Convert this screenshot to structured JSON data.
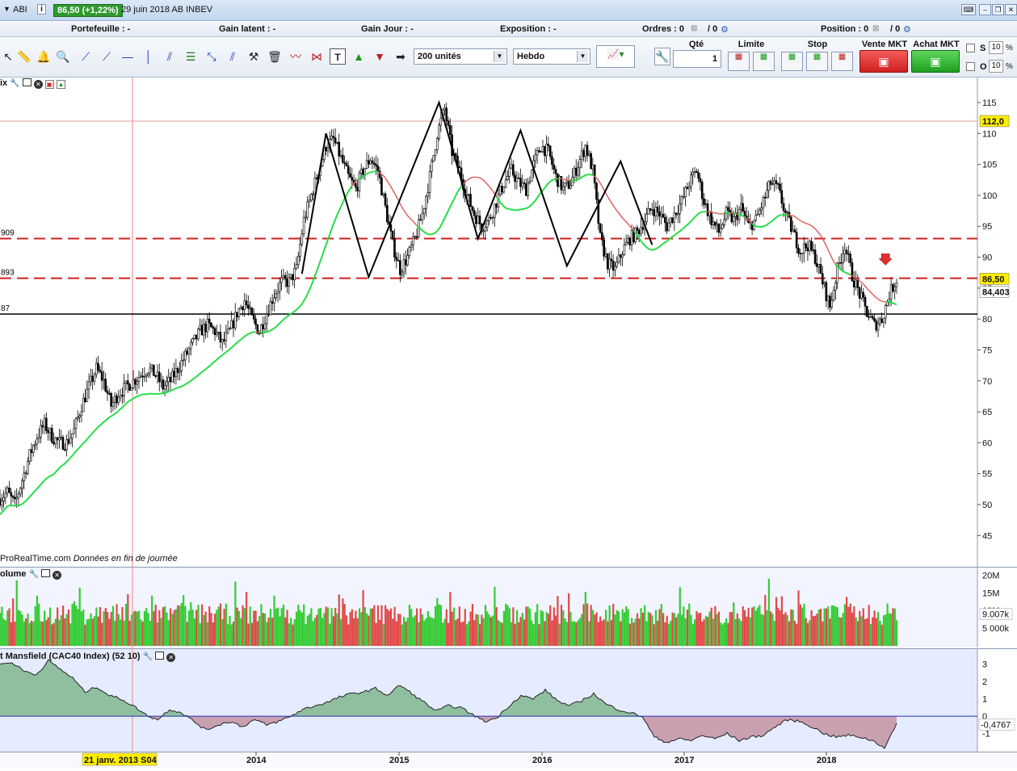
{
  "window": {
    "ticker": "ABI",
    "price_badge": "86,50 (+1,22%)",
    "title": "29 juin 2018 AB INBEV"
  },
  "infobar": {
    "portefeuille": "Portefeuille : -",
    "gain_latent": "Gain latent : -",
    "gain_jour": "Gain Jour : -",
    "exposition": "Exposition : -",
    "ordres": "Ordres : 0",
    "ordres2": "/ 0",
    "position": "Position : 0",
    "position2": "/ 0"
  },
  "toolbar": {
    "units_select": "200 unités",
    "period_select": "Hebdo",
    "qte_label": "Qté",
    "qte_value": "1",
    "limite_label": "Limite",
    "stop_label": "Stop",
    "vente_label": "Vente MKT",
    "achat_label": "Achat MKT",
    "s_label": "S",
    "o_label": "O",
    "pct1": "10",
    "pct2": "10",
    "pct_sign": "%"
  },
  "panels": {
    "price_title": "ix",
    "volume_title": "olume",
    "mansfield_title": "t Mansfield (CAC40 Index) (52 10)",
    "source_note": "ProRealTime.com",
    "source_note2": "Données en fin de journée"
  },
  "chart_data": [
    {
      "type": "candlestick",
      "name": "price",
      "y_ticks": [
        45,
        50,
        55,
        60,
        65,
        70,
        75,
        80,
        85,
        90,
        95,
        100,
        105,
        110,
        115
      ],
      "ylim": [
        41,
        118
      ],
      "x_years": [
        "2014",
        "2015",
        "2016",
        "2017",
        "2018"
      ],
      "cursor_label": "21 janv. 2013 S04",
      "price_tags": {
        "resistance": "112,0",
        "last": "86,50",
        "ma": "84,403"
      },
      "levels": [
        {
          "value": 93.0,
          "label": "909",
          "style": "dashed",
          "color": "#d21f1f"
        },
        {
          "value": 86.6,
          "label": "893",
          "style": "dashed",
          "color": "#d21f1f"
        },
        {
          "value": 80.8,
          "label": "87",
          "style": "solid",
          "color": "#000000"
        },
        {
          "value": 112.0,
          "label": "",
          "style": "thin",
          "color": "#d08080"
        }
      ],
      "close_path": [
        [
          0,
          51
        ],
        [
          4,
          52
        ],
        [
          8,
          50
        ],
        [
          12,
          54
        ],
        [
          16,
          58
        ],
        [
          20,
          61
        ],
        [
          24,
          63
        ],
        [
          28,
          61
        ],
        [
          32,
          60
        ],
        [
          36,
          60
        ],
        [
          40,
          62
        ],
        [
          44,
          66
        ],
        [
          48,
          69
        ],
        [
          52,
          72
        ],
        [
          56,
          70
        ],
        [
          60,
          66
        ],
        [
          64,
          68
        ],
        [
          68,
          69
        ],
        [
          72,
          70
        ],
        [
          76,
          71
        ],
        [
          80,
          72
        ],
        [
          84,
          71
        ],
        [
          88,
          69
        ],
        [
          92,
          70
        ],
        [
          96,
          72
        ],
        [
          100,
          74
        ],
        [
          104,
          76
        ],
        [
          108,
          78
        ],
        [
          112,
          79
        ],
        [
          116,
          78
        ],
        [
          120,
          76
        ],
        [
          124,
          78
        ],
        [
          128,
          81
        ],
        [
          132,
          83
        ],
        [
          136,
          80
        ],
        [
          140,
          78
        ],
        [
          144,
          81
        ],
        [
          148,
          84
        ],
        [
          152,
          86
        ],
        [
          156,
          86
        ],
        [
          160,
          88
        ],
        [
          164,
          96
        ],
        [
          168,
          100
        ],
        [
          172,
          104
        ],
        [
          176,
          108
        ],
        [
          180,
          109
        ],
        [
          184,
          106
        ],
        [
          188,
          103
        ],
        [
          192,
          101
        ],
        [
          196,
          104
        ],
        [
          200,
          106
        ],
        [
          204,
          104
        ],
        [
          208,
          98
        ],
        [
          212,
          92
        ],
        [
          216,
          88
        ],
        [
          220,
          90
        ],
        [
          224,
          93
        ],
        [
          228,
          97
        ],
        [
          232,
          103
        ],
        [
          236,
          110
        ],
        [
          240,
          114
        ],
        [
          244,
          107
        ],
        [
          248,
          104
        ],
        [
          252,
          100
        ],
        [
          256,
          97
        ],
        [
          260,
          95
        ],
        [
          264,
          96
        ],
        [
          268,
          99
        ],
        [
          272,
          102
        ],
        [
          276,
          104
        ],
        [
          280,
          102
        ],
        [
          284,
          101
        ],
        [
          288,
          105
        ],
        [
          292,
          108
        ],
        [
          296,
          107
        ],
        [
          300,
          103
        ],
        [
          304,
          101
        ],
        [
          308,
          102
        ],
        [
          312,
          105
        ],
        [
          316,
          108
        ],
        [
          320,
          104
        ],
        [
          324,
          93
        ],
        [
          328,
          89
        ],
        [
          332,
          88
        ],
        [
          336,
          91
        ],
        [
          340,
          93
        ],
        [
          344,
          94
        ],
        [
          348,
          96
        ],
        [
          352,
          98
        ],
        [
          356,
          97
        ],
        [
          360,
          95
        ],
        [
          364,
          97
        ],
        [
          368,
          99
        ],
        [
          372,
          102
        ],
        [
          376,
          104
        ],
        [
          380,
          99
        ],
        [
          384,
          96
        ],
        [
          388,
          94
        ],
        [
          392,
          97
        ],
        [
          396,
          96
        ],
        [
          400,
          98
        ],
        [
          404,
          95
        ],
        [
          408,
          96
        ],
        [
          412,
          99
        ],
        [
          416,
          102
        ],
        [
          420,
          101
        ],
        [
          424,
          97
        ],
        [
          428,
          94
        ],
        [
          432,
          91
        ],
        [
          436,
          92
        ],
        [
          440,
          90
        ],
        [
          444,
          86
        ],
        [
          448,
          82
        ],
        [
          452,
          88
        ],
        [
          456,
          92
        ],
        [
          460,
          87
        ],
        [
          464,
          84
        ],
        [
          468,
          81
        ],
        [
          472,
          79
        ],
        [
          476,
          80
        ],
        [
          480,
          84
        ],
        [
          484,
          86.5
        ]
      ]
    },
    {
      "type": "bar",
      "name": "volume",
      "y_ticks": [
        "20M",
        "15M",
        "10M",
        "5 000k"
      ],
      "y_tick_values": [
        20,
        15,
        10,
        5
      ],
      "ylim": [
        0,
        21
      ],
      "last_tag": "9.007k"
    },
    {
      "type": "area",
      "name": "mansfield",
      "y_ticks": [
        3,
        2,
        1,
        0,
        -1
      ],
      "ylim": [
        -1.9,
        3.5
      ],
      "last_tag": "-0,4767",
      "values": [
        [
          0,
          3.0
        ],
        [
          10,
          3.1
        ],
        [
          20,
          2.6
        ],
        [
          30,
          2.4
        ],
        [
          40,
          3.2
        ],
        [
          50,
          2.7
        ],
        [
          60,
          2.2
        ],
        [
          70,
          1.4
        ],
        [
          80,
          1.7
        ],
        [
          90,
          1.2
        ],
        [
          100,
          1.0
        ],
        [
          110,
          0.6
        ],
        [
          120,
          0.1
        ],
        [
          130,
          -0.2
        ],
        [
          140,
          0.4
        ],
        [
          150,
          0.2
        ],
        [
          160,
          -0.3
        ],
        [
          170,
          -0.8
        ],
        [
          180,
          -0.5
        ],
        [
          190,
          -0.3
        ],
        [
          200,
          -0.6
        ],
        [
          210,
          -0.2
        ],
        [
          220,
          -0.5
        ],
        [
          230,
          -0.3
        ],
        [
          240,
          0.0
        ],
        [
          250,
          0.4
        ],
        [
          260,
          0.6
        ],
        [
          270,
          0.8
        ],
        [
          280,
          1.1
        ],
        [
          290,
          1.3
        ],
        [
          300,
          1.4
        ],
        [
          310,
          1.6
        ],
        [
          320,
          1.2
        ],
        [
          330,
          1.8
        ],
        [
          340,
          1.3
        ],
        [
          350,
          0.8
        ],
        [
          360,
          0.3
        ],
        [
          370,
          0.6
        ],
        [
          380,
          0.5
        ],
        [
          390,
          0.1
        ],
        [
          400,
          -0.3
        ],
        [
          410,
          -0.1
        ],
        [
          420,
          0.6
        ],
        [
          430,
          1.2
        ],
        [
          440,
          1.0
        ],
        [
          450,
          1.5
        ],
        [
          460,
          0.9
        ],
        [
          470,
          0.6
        ],
        [
          480,
          0.9
        ],
        [
          490,
          1.3
        ],
        [
          500,
          0.7
        ],
        [
          510,
          0.4
        ],
        [
          520,
          0.2
        ],
        [
          530,
          0.0
        ],
        [
          540,
          -1.2
        ],
        [
          550,
          -1.5
        ],
        [
          560,
          -1.3
        ],
        [
          570,
          -1.4
        ],
        [
          580,
          -1.1
        ],
        [
          590,
          -1.3
        ],
        [
          600,
          -1.0
        ],
        [
          610,
          -1.4
        ],
        [
          620,
          -1.2
        ],
        [
          630,
          -1.1
        ],
        [
          640,
          -0.6
        ],
        [
          650,
          -0.2
        ],
        [
          660,
          -0.3
        ],
        [
          670,
          -0.6
        ],
        [
          680,
          -1.0
        ],
        [
          690,
          -1.2
        ],
        [
          700,
          -1.1
        ],
        [
          710,
          -1.2
        ],
        [
          720,
          -1.4
        ],
        [
          730,
          -1.8
        ],
        [
          740,
          -0.48
        ]
      ]
    }
  ]
}
